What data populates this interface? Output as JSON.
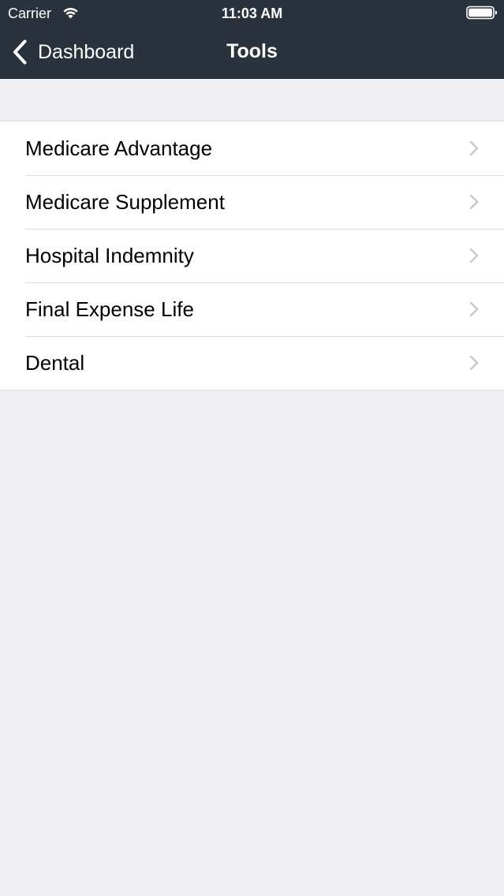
{
  "status_bar": {
    "carrier": "Carrier",
    "time": "11:03 AM",
    "wifi_icon": "wifi-icon",
    "battery_icon": "battery-icon"
  },
  "nav_bar": {
    "back_label": "Dashboard",
    "back_icon": "chevron-left-icon",
    "title": "Tools"
  },
  "tools": {
    "row_icon": "chevron-right-icon",
    "items": [
      {
        "label": "Medicare Advantage"
      },
      {
        "label": "Medicare Supplement"
      },
      {
        "label": "Hospital Indemnity"
      },
      {
        "label": "Final Expense Life"
      },
      {
        "label": "Dental"
      }
    ]
  },
  "colors": {
    "nav_background": "#2a323e",
    "page_background": "#efeff4",
    "list_background": "#ffffff",
    "separator": "#dcdce0",
    "chevron": "#c7c7cc",
    "text_primary": "#000000",
    "text_on_nav": "#ffffff"
  }
}
